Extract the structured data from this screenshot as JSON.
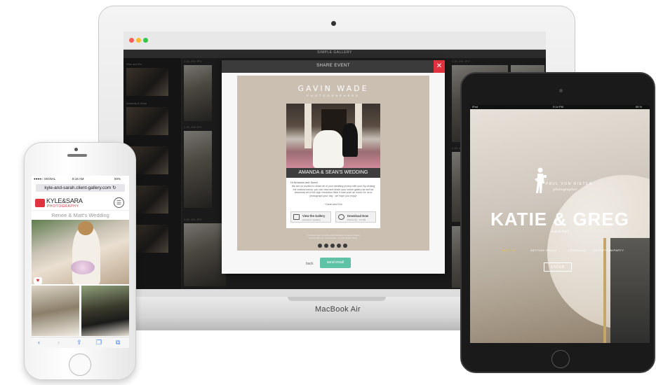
{
  "laptop": {
    "model_label": "MacBook Air",
    "window_dots": [
      "#fc5f57",
      "#fdbc2e",
      "#33c748"
    ],
    "gallery_bar_title": "SIMPLE GALLERY",
    "left_labels": [
      "Wes and Flo",
      "Amanda & Sean"
    ],
    "size_tags": [
      "2,48, 490 JPG",
      "2,48, 490 JPG",
      "2,48, 490 JPG",
      "2,48, 490 JPG",
      "2,48, 490 JPG"
    ],
    "modal": {
      "title": "SHARE EVENT",
      "close_glyph": "✕",
      "email": {
        "brand": "GAVIN WADE",
        "brand_sub": "PHOTOGRAPHERS",
        "event_title": "AMANDA & SEAN'S WEDDING",
        "greeting": "Hi Amanda and Sean!",
        "message": "We are so excited to share all of your wedding photos with you! By clicking the buttons below, you can view and share your online gallery as well as download all of the high resolution files! It was such an honor for us to photograph your day - we hope you enjoy!",
        "signoff": "~Gavin and Erin",
        "view_button": {
          "label": "View the Gallery",
          "sub": "password: wedding"
        },
        "download_button": {
          "label": "Download Now",
          "sub": "Photos.zip · 1.2 GB"
        },
        "footer_lines": [
          "You have been sent this email because someone shared",
          "photos with you. Unsubscribe · Contact Gavin Wade"
        ]
      },
      "back_label": "back",
      "send_label": "send email"
    }
  },
  "phone": {
    "status": {
      "carrier": "●●●●○ SIGNAL",
      "time": "8:16 AM",
      "battery": "50%"
    },
    "url": "kyle-and-sarah.client-gallery.com",
    "logo_main": "KYLE&SARA",
    "logo_sub": "PHOTOGRAPHY",
    "menu_glyph": "☰",
    "gallery_title": "Renee & Matt's Wedding",
    "heart_glyph": "♥",
    "toolbar": [
      "‹",
      "›",
      "⇪",
      "❐",
      "⧉"
    ]
  },
  "tablet": {
    "status": {
      "device": "iPad",
      "time": "9:14 PM",
      "battery": "55 %"
    },
    "brand": "PAUL VON RIETER",
    "brand_sub": "photographer",
    "title": "KATIE & GREG",
    "date": "August 2013",
    "nav": [
      {
        "label": "BEST OF",
        "active": true
      },
      {
        "label": "GETTING READY",
        "active": false
      },
      {
        "label": "CEREMONY",
        "active": false
      },
      {
        "label": "RECEPTION/PARTY",
        "active": false
      }
    ],
    "enter_label": "ENTER",
    "accent": "#f0c23a"
  }
}
